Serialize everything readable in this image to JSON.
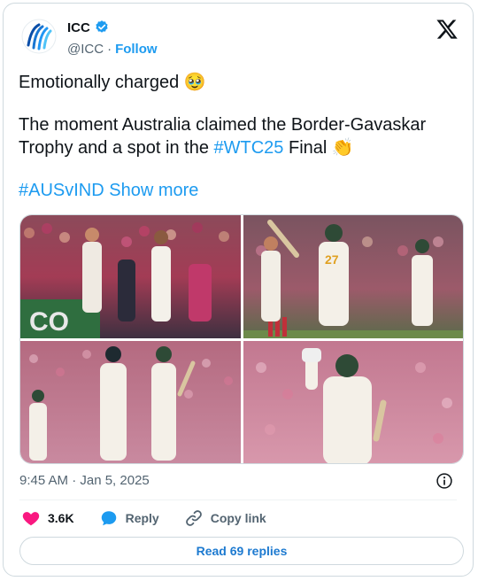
{
  "author": {
    "name": "ICC",
    "handle": "@ICC",
    "separator": "·",
    "follow_label": "Follow",
    "verified": true
  },
  "tweet": {
    "line1": "Emotionally charged",
    "line1_emoji": "🥹",
    "line2": "The moment Australia claimed the Border-Gavaskar Trophy and a spot in the",
    "hashtag_wtc": "#WTC25",
    "line2_end": "Final",
    "line2_emoji": "👏",
    "hashtag_match": "#AUSvIND",
    "show_more_label": "Show more"
  },
  "timestamp": "9:45 AM · Jan 5, 2025",
  "actions": {
    "likes_count": "3.6K",
    "reply_label": "Reply",
    "copy_link_label": "Copy link"
  },
  "read_replies_label": "Read 69 replies",
  "colors": {
    "accent_blue": "#1d9bf0",
    "like_pink": "#f91880",
    "muted_text": "#536471",
    "border": "#cfd9de"
  },
  "icons": [
    "icc-logo-icon",
    "verified-badge-icon",
    "x-logo-icon",
    "info-icon",
    "heart-icon",
    "reply-bubble-icon",
    "link-icon"
  ]
}
